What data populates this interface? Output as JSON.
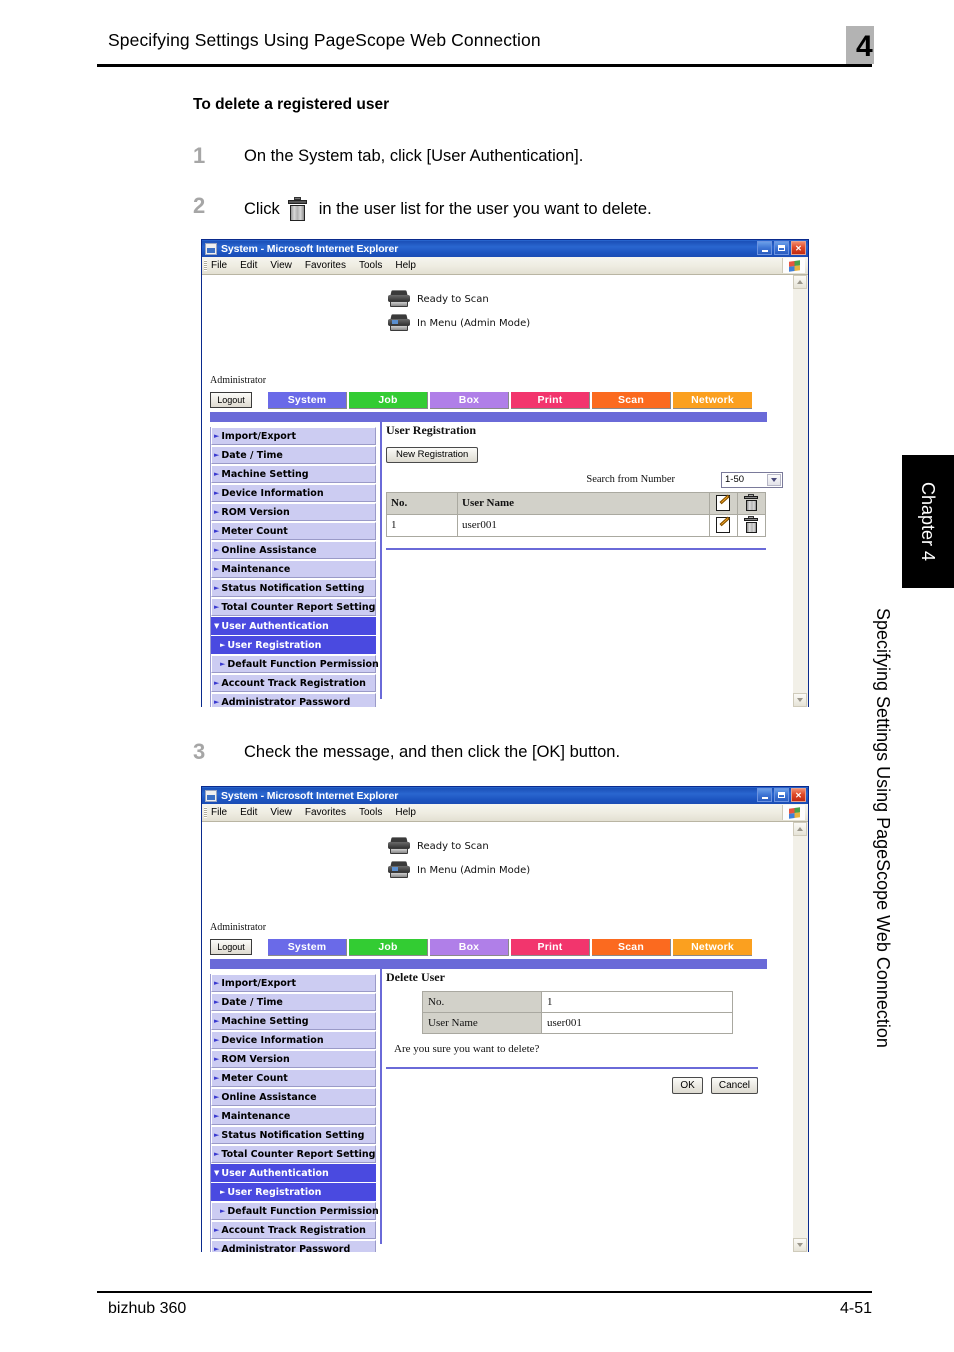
{
  "header": {
    "running_head": "Specifying Settings Using PageScope Web Connection",
    "chapter_number": "4"
  },
  "section": {
    "heading": "To delete a registered user"
  },
  "steps": [
    {
      "number": "1",
      "text": "On the System tab, click [User Authentication]."
    },
    {
      "number": "2",
      "text_before": "Click",
      "icon": "trash-icon",
      "text_after": "in the user list for the user you want to delete."
    },
    {
      "number": "3",
      "text": "Check the message, and then click the [OK] button."
    }
  ],
  "browser": {
    "title": "System - Microsoft Internet Explorer",
    "menu": [
      "File",
      "Edit",
      "View",
      "Favorites",
      "Tools",
      "Help"
    ],
    "window_buttons": [
      "minimize-button",
      "maximize-button",
      "close-button"
    ]
  },
  "webpage": {
    "status": [
      {
        "icon": "scanner-icon",
        "text": "Ready to Scan"
      },
      {
        "icon": "printer-icon",
        "text": "In Menu (Admin Mode)"
      }
    ],
    "user_label": "Administrator",
    "logout_label": "Logout",
    "tabs": [
      {
        "label": "System",
        "color": "#6a6ae8"
      },
      {
        "label": "Job",
        "color": "#33cc33"
      },
      {
        "label": "Box",
        "color": "#b07fe8"
      },
      {
        "label": "Print",
        "color": "#f2356d"
      },
      {
        "label": "Scan",
        "color": "#fb6a1f"
      },
      {
        "label": "Network",
        "color": "#fba01f"
      }
    ],
    "sidebar": [
      {
        "label": "Import/Export",
        "selected": false,
        "sub": false,
        "arrow": "►"
      },
      {
        "label": "Date / Time",
        "selected": false,
        "sub": false,
        "arrow": "►"
      },
      {
        "label": "Machine Setting",
        "selected": false,
        "sub": false,
        "arrow": "►"
      },
      {
        "label": "Device Information",
        "selected": false,
        "sub": false,
        "arrow": "►"
      },
      {
        "label": "ROM Version",
        "selected": false,
        "sub": false,
        "arrow": "►"
      },
      {
        "label": "Meter Count",
        "selected": false,
        "sub": false,
        "arrow": "►"
      },
      {
        "label": "Online Assistance",
        "selected": false,
        "sub": false,
        "arrow": "►"
      },
      {
        "label": "Maintenance",
        "selected": false,
        "sub": false,
        "arrow": "►"
      },
      {
        "label": "Status Notification Setting",
        "selected": false,
        "sub": false,
        "arrow": "►"
      },
      {
        "label": "Total Counter Report Setting",
        "selected": false,
        "sub": false,
        "arrow": "►"
      },
      {
        "label": "User Authentication",
        "selected": true,
        "sub": false,
        "arrow": "▼"
      },
      {
        "label": "User Registration",
        "selected": true,
        "sub": true,
        "arrow": "►"
      },
      {
        "label": "Default Function Permission",
        "selected": false,
        "sub": true,
        "arrow": "►"
      },
      {
        "label": "Account Track Registration",
        "selected": false,
        "sub": false,
        "arrow": "►"
      },
      {
        "label": "Administrator Password",
        "selected": false,
        "sub": false,
        "arrow": "►"
      }
    ]
  },
  "screen1": {
    "panel_title": "User Registration",
    "new_registration_label": "New Registration",
    "search_label": "Search from Number",
    "search_value": "1-50",
    "table": {
      "headers": [
        "No.",
        "User Name"
      ],
      "header_icons": [
        "edit-icon",
        "delete-icon"
      ],
      "rows": [
        {
          "no": "1",
          "user_name": "user001",
          "icons": [
            "edit-icon",
            "delete-icon"
          ]
        }
      ]
    }
  },
  "screen2": {
    "panel_title": "Delete User",
    "fields": [
      {
        "label": "No.",
        "value": "1"
      },
      {
        "label": "User Name",
        "value": "user001"
      }
    ],
    "confirm_message": "Are you sure you want to delete?",
    "ok_label": "OK",
    "cancel_label": "Cancel"
  },
  "side_tab": {
    "chapter_label": "Chapter 4",
    "running_head": "Specifying Settings Using PageScope Web Connection"
  },
  "footer": {
    "product": "bizhub 360",
    "page_number": "4-51"
  }
}
